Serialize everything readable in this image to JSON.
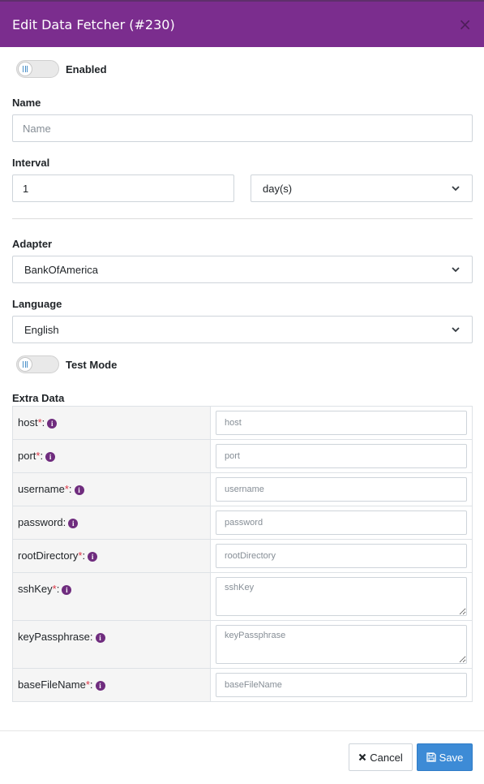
{
  "modal": {
    "title": "Edit Data Fetcher (#230)",
    "close_glyph": "×"
  },
  "enabled_toggle": {
    "label": "Enabled",
    "on": false
  },
  "name": {
    "label": "Name",
    "value": "",
    "placeholder": "Name"
  },
  "interval": {
    "label": "Interval",
    "value": "1",
    "unit": "day(s)"
  },
  "adapter": {
    "label": "Adapter",
    "value": "BankOfAmerica"
  },
  "language": {
    "label": "Language",
    "value": "English"
  },
  "test_mode_toggle": {
    "label": "Test Mode",
    "on": false
  },
  "extra_data": {
    "label": "Extra Data",
    "rows": [
      {
        "key": "host",
        "required": true,
        "placeholder": "host",
        "multiline": false
      },
      {
        "key": "port",
        "required": true,
        "placeholder": "port",
        "multiline": false
      },
      {
        "key": "username",
        "required": true,
        "placeholder": "username",
        "multiline": false
      },
      {
        "key": "password",
        "required": false,
        "placeholder": "password",
        "multiline": false
      },
      {
        "key": "rootDirectory",
        "required": true,
        "placeholder": "rootDirectory",
        "multiline": false
      },
      {
        "key": "sshKey",
        "required": true,
        "placeholder": "sshKey",
        "multiline": true
      },
      {
        "key": "keyPassphrase",
        "required": false,
        "placeholder": "keyPassphrase",
        "multiline": true
      },
      {
        "key": "baseFileName",
        "required": true,
        "placeholder": "baseFileName",
        "multiline": false
      }
    ]
  },
  "footer": {
    "cancel_label": "Cancel",
    "save_label": "Save"
  },
  "colors": {
    "header": "#7b2d8e",
    "save": "#3d8bd6",
    "required": "#dc3545",
    "info_icon": "#6f2c7e"
  },
  "icons": {
    "close": "close-icon",
    "chevron": "chevron-down-icon",
    "info": "info-icon",
    "cancel": "times-icon",
    "save": "floppy-disk-icon"
  }
}
